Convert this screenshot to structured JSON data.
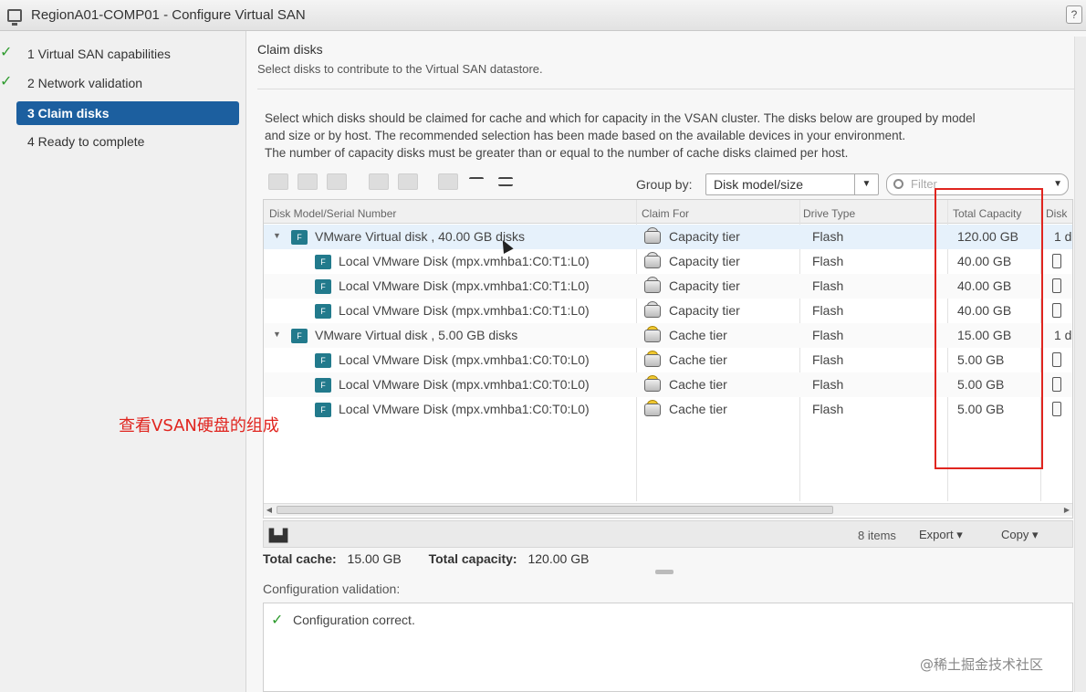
{
  "window": {
    "title": "RegionA01-COMP01 - Configure Virtual SAN",
    "help": "?"
  },
  "steps": [
    {
      "label": "1  Virtual SAN capabilities",
      "done": true
    },
    {
      "label": "2  Network validation",
      "done": true
    },
    {
      "label": "3  Claim disks",
      "active": true
    },
    {
      "label": "4  Ready to complete"
    }
  ],
  "page": {
    "title": "Claim disks",
    "subtitle": "Select disks to contribute to the Virtual SAN datastore.",
    "desc1": "Select which disks should be claimed for cache and which for capacity in the VSAN cluster. The disks below are grouped by model",
    "desc2": "and size or by host. The recommended selection has been made based on the available devices in your environment.",
    "desc3": "The number of capacity disks must be greater than or equal to the number of cache disks claimed per host."
  },
  "toolbar": {
    "group_by_label": "Group by:",
    "group_by_value": "Disk model/size",
    "filter_placeholder": "Filter"
  },
  "grid": {
    "headers": [
      "Disk Model/Serial Number",
      "Claim For",
      "Drive Type",
      "Total Capacity",
      "Disk"
    ],
    "rows": [
      {
        "model": "VMware   Virtual disk    , 40.00 GB disks",
        "claim": "Capacity tier",
        "drive": "Flash",
        "cap": "120.00 GB",
        "disk": "1 d",
        "group": true
      },
      {
        "model": "Local VMware Disk (mpx.vmhba1:C0:T1:L0)",
        "claim": "Capacity tier",
        "drive": "Flash",
        "cap": "40.00 GB"
      },
      {
        "model": "Local VMware Disk (mpx.vmhba1:C0:T1:L0)",
        "claim": "Capacity tier",
        "drive": "Flash",
        "cap": "40.00 GB"
      },
      {
        "model": "Local VMware Disk (mpx.vmhba1:C0:T1:L0)",
        "claim": "Capacity tier",
        "drive": "Flash",
        "cap": "40.00 GB"
      },
      {
        "model": "VMware   Virtual disk    , 5.00 GB disks",
        "claim": "Cache tier",
        "drive": "Flash",
        "cap": "15.00 GB",
        "disk": "1 d",
        "group": true
      },
      {
        "model": "Local VMware Disk (mpx.vmhba1:C0:T0:L0)",
        "claim": "Cache tier",
        "drive": "Flash",
        "cap": "5.00 GB"
      },
      {
        "model": "Local VMware Disk (mpx.vmhba1:C0:T0:L0)",
        "claim": "Cache tier",
        "drive": "Flash",
        "cap": "5.00 GB"
      },
      {
        "model": "Local VMware Disk (mpx.vmhba1:C0:T0:L0)",
        "claim": "Cache tier",
        "drive": "Flash",
        "cap": "5.00 GB"
      }
    ],
    "footer": {
      "items": "8 items",
      "export": "Export",
      "copy": "Copy"
    }
  },
  "totals": {
    "cache_label": "Total cache:",
    "cache_value": "15.00 GB",
    "capacity_label": "Total capacity:",
    "capacity_value": "120.00 GB"
  },
  "validation": {
    "label": "Configuration validation:",
    "message": "Configuration correct."
  },
  "annotation": "查看VSAN硬盘的组成",
  "watermark": "@稀土掘金技术社区",
  "colors": {
    "accent": "#1c5f9f",
    "annotation": "#e0251f",
    "check": "#2e9b2e"
  }
}
